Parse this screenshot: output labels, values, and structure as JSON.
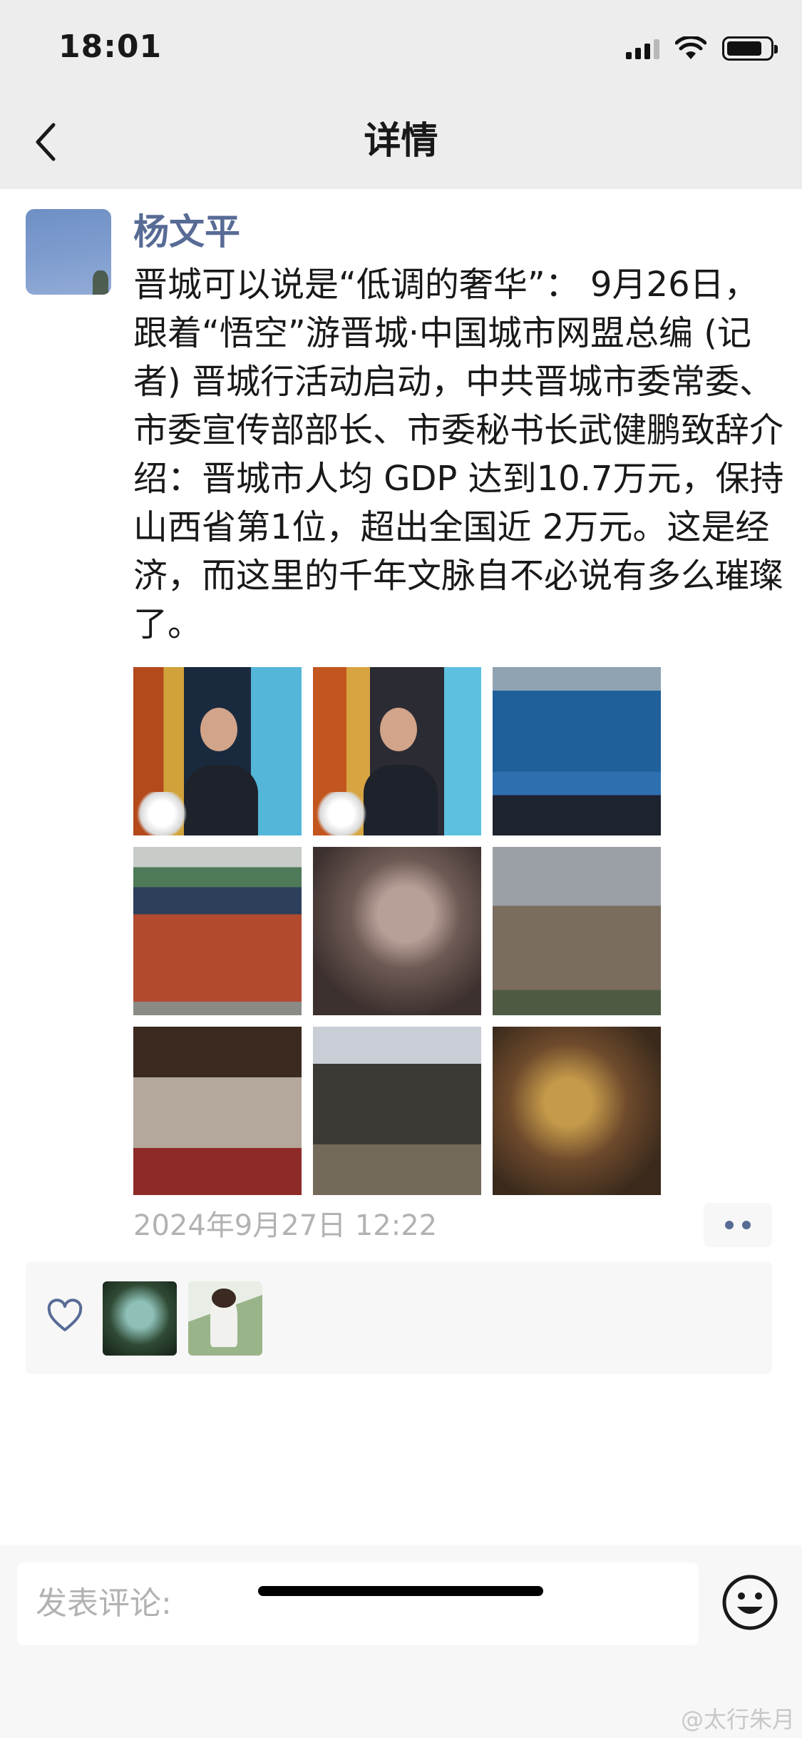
{
  "status_bar": {
    "time": "18:01"
  },
  "header": {
    "title": "详情"
  },
  "post": {
    "username": "杨文平",
    "text": "晋城可以说是“低调的奢华”： 9月26日，跟着“悟空”游晋城·中国城市网盟总编 (记者) 晋城行活动启动，中共晋城市委常委、市委宣传部部长、市委秘书长武健鹏致辞介绍：晋城市人均 GDP 达到10.7万元，保持山西省第1位，超出全国近 2万元。这是经济，而这里的千年文脉自不必说有多么璀璨了。",
    "photos": [
      "speaker-at-podium-photo",
      "second-speaker-at-podium-photo",
      "event-stage-screen-photo",
      "red-temple-gate-photo",
      "carved-relief-photo",
      "ancient-pagoda-photo",
      "buddha-statues-hall-photo",
      "temple-hall-visitors-photo",
      "mural-painting-photo"
    ],
    "timestamp": "2024年9月27日 12:22"
  },
  "likes": {
    "users": [
      "liker-avatar-1",
      "liker-avatar-2"
    ]
  },
  "comment_bar": {
    "placeholder": "发表评论:"
  },
  "watermark": "@太行朱月",
  "colors": {
    "nav_background": "#ededed",
    "username": "#576b95",
    "timestamp": "#b2b2b2",
    "likes_background": "#f7f7f7"
  }
}
